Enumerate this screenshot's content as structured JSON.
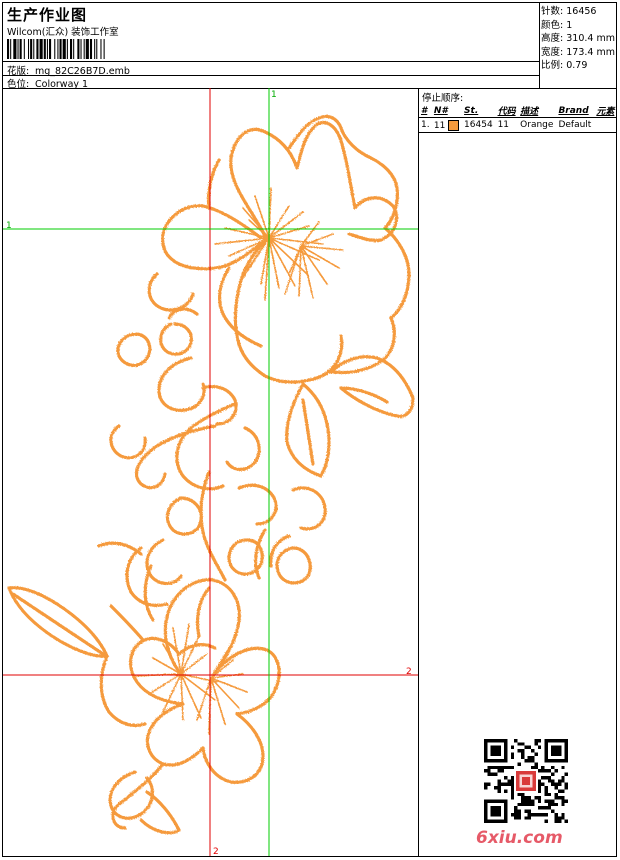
{
  "header": {
    "title": "生产作业图",
    "subtitle": "Wilcom(汇众) 装饰工作室",
    "design_label": "花版:",
    "design_value": "mg_82C26B7D.emb",
    "color_label": "色位:",
    "color_value": "Colorway 1"
  },
  "stats": [
    {
      "label": "针数:",
      "value": "16456"
    },
    {
      "label": "颜色:",
      "value": "1"
    },
    {
      "label": "高度:",
      "value": "310.4 mm"
    },
    {
      "label": "宽度:",
      "value": "173.4 mm"
    },
    {
      "label": "比例:",
      "value": "0.79"
    }
  ],
  "stop_sequence": {
    "title": "停止顺序:",
    "columns": [
      "#",
      "N#",
      "St.",
      "代码",
      "描述",
      "Brand",
      "元素"
    ],
    "rows": [
      {
        "index": "1.",
        "n": "11",
        "swatch_color": "#f59a3c",
        "stitches": "16454",
        "code": "11",
        "description": "Orange",
        "brand": "Default"
      }
    ]
  },
  "guides": {
    "green_label_1_top": "1",
    "green_label_1_left": "1",
    "red_label_2_right": "2",
    "red_label_2_bottom": "2"
  },
  "watermark": "6xiu.com",
  "colors": {
    "thread": "#f59a3c",
    "guide_red": "#e00000",
    "guide_green": "#00cc00",
    "watermark": "#e65a68"
  }
}
